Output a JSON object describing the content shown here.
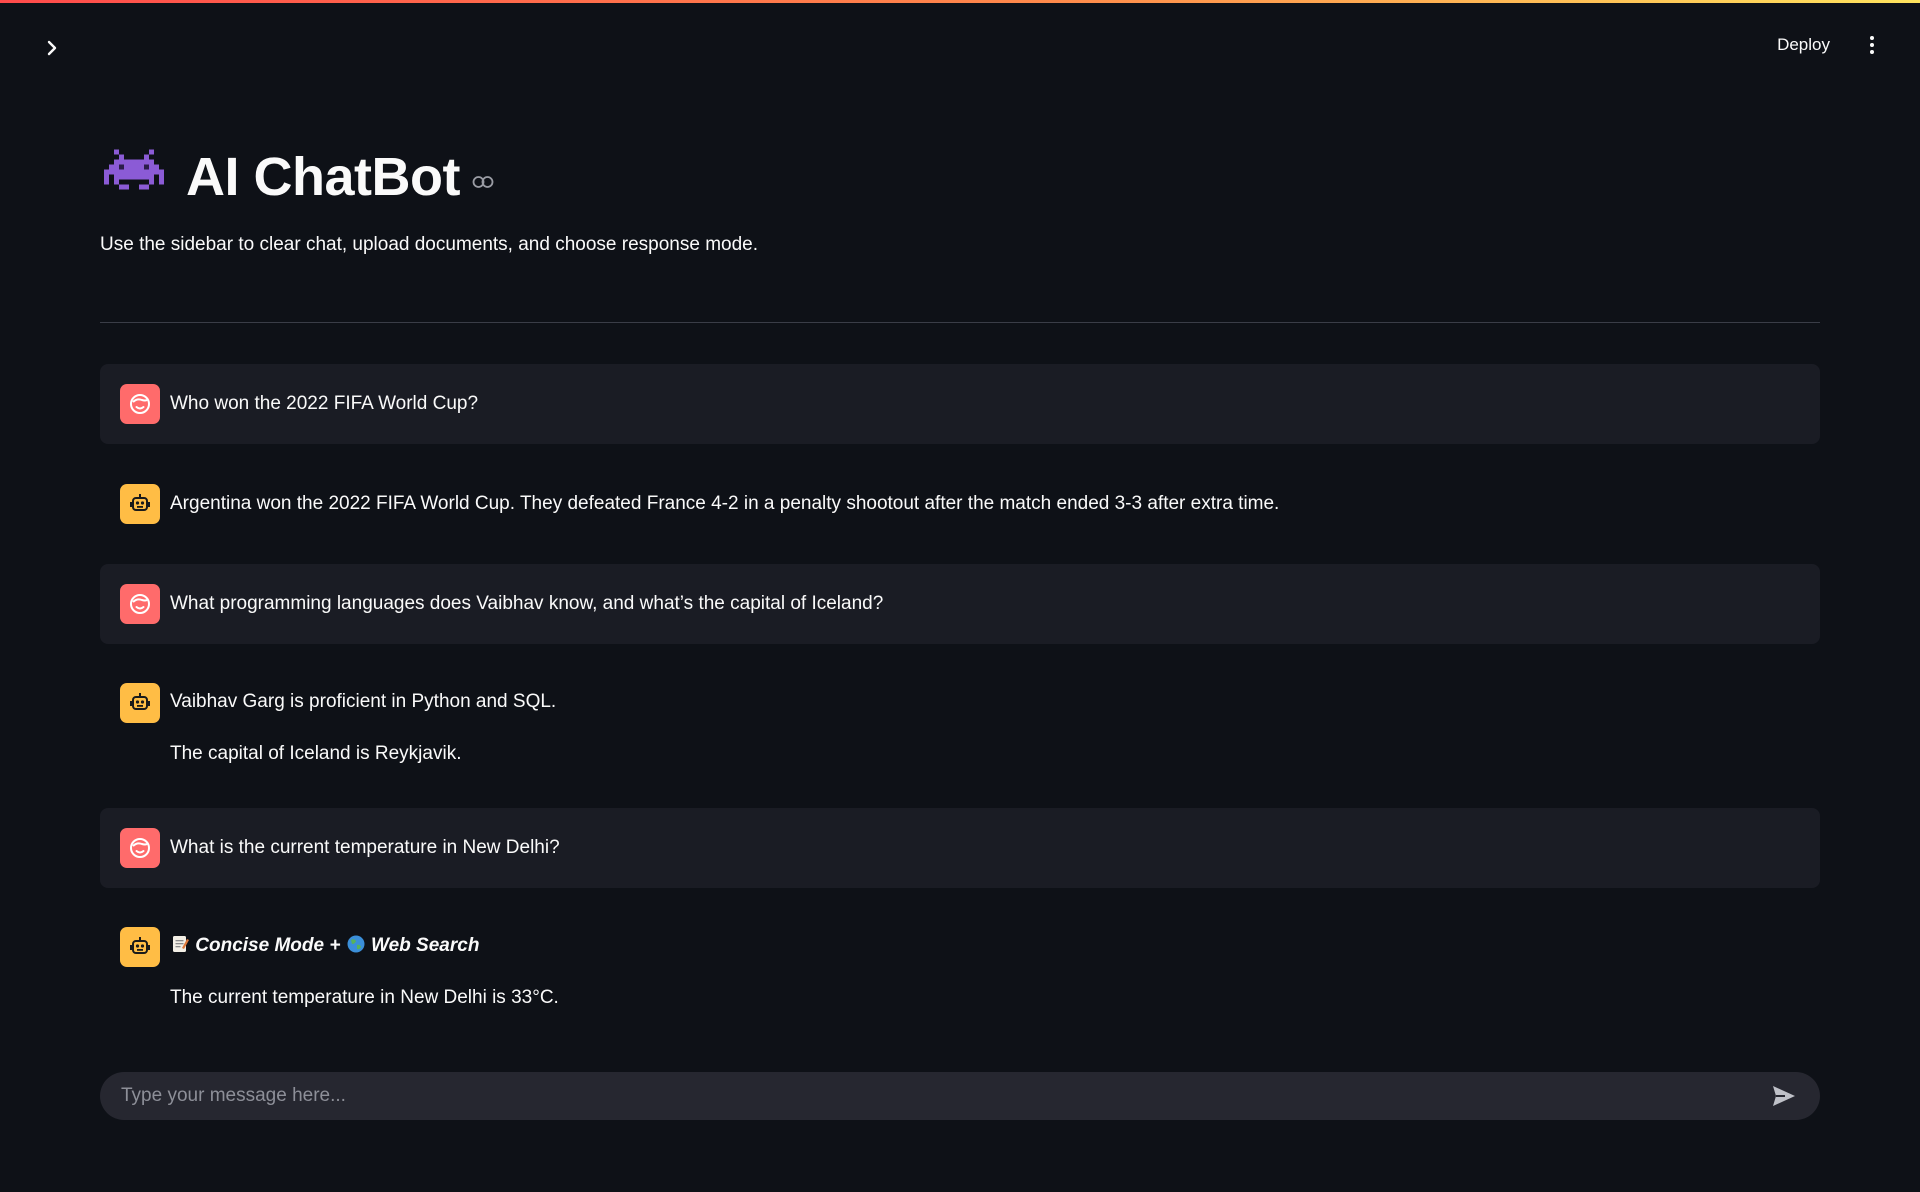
{
  "header": {
    "deploy_label": "Deploy"
  },
  "page": {
    "title": "AI ChatBot",
    "subtitle": "Use the sidebar to clear chat, upload documents, and choose response mode."
  },
  "messages": [
    {
      "role": "user",
      "lines": [
        "Who won the 2022 FIFA World Cup?"
      ]
    },
    {
      "role": "assistant",
      "lines": [
        "Argentina won the 2022 FIFA World Cup. They defeated France 4-2 in a penalty shootout after the match ended 3-3 after extra time."
      ]
    },
    {
      "role": "user",
      "lines": [
        "What programming languages does Vaibhav know, and what’s the capital of Iceland?"
      ]
    },
    {
      "role": "assistant",
      "lines": [
        "Vaibhav Garg is proficient in Python and SQL.",
        "The capital of Iceland is Reykjavik."
      ]
    },
    {
      "role": "user",
      "lines": [
        "What is the current temperature in New Delhi?"
      ]
    },
    {
      "role": "assistant",
      "mode": {
        "concise": "Concise Mode +",
        "web": "Web Search"
      },
      "lines": [
        "The current temperature in New Delhi is 33°C."
      ]
    }
  ],
  "chat_input": {
    "placeholder": "Type your message here..."
  },
  "icons": {
    "title": "alien-monster-icon",
    "anchor": "link-icon",
    "user_avatar": "user-face-icon",
    "bot_avatar": "robot-icon",
    "mode_concise": "memo-icon",
    "mode_web": "globe-icon",
    "send": "send-icon",
    "sidebar": "chevron-right-icon",
    "menu": "more-vertical-icon"
  },
  "colors": {
    "background": "#0e1117",
    "user_bubble": "#1a1c24",
    "user_avatar": "#ff6b6b",
    "bot_avatar": "#ffbd45",
    "input_bg": "#262730"
  }
}
